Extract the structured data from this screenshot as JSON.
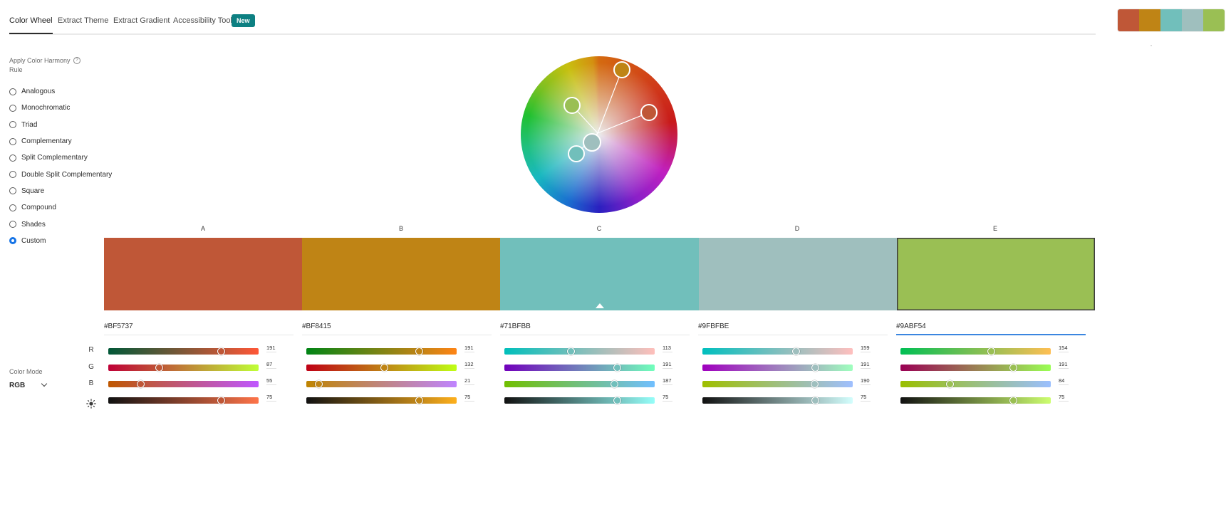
{
  "tabs": [
    {
      "label": "Color Wheel",
      "active": true
    },
    {
      "label": "Extract Theme",
      "active": false
    },
    {
      "label": "Extract Gradient",
      "active": false
    },
    {
      "label": "Accessibility Tools",
      "active": false
    }
  ],
  "new_badge": "New",
  "mini_palette": [
    "#BF5737",
    "#BF8415",
    "#71BFBB",
    "#9FBFBE",
    "#9ABF54"
  ],
  "sidebar": {
    "harmony_label": "Apply Color Harmony Rule",
    "help_icon": "?",
    "rules": [
      {
        "label": "Analogous",
        "checked": false
      },
      {
        "label": "Monochromatic",
        "checked": false
      },
      {
        "label": "Triad",
        "checked": false
      },
      {
        "label": "Complementary",
        "checked": false
      },
      {
        "label": "Split Complementary",
        "checked": false
      },
      {
        "label": "Double Split Complementary",
        "checked": false
      },
      {
        "label": "Square",
        "checked": false
      },
      {
        "label": "Compound",
        "checked": false
      },
      {
        "label": "Shades",
        "checked": false
      },
      {
        "label": "Custom",
        "checked": true
      }
    ],
    "color_mode_label": "Color Mode",
    "color_mode_value": "RGB"
  },
  "channels": [
    "R",
    "G",
    "B"
  ],
  "brightness_icon": "sun-icon",
  "swatches": [
    {
      "letter": "A",
      "hex": "#BF5737",
      "color": "#BF5737",
      "r": 191,
      "g": 87,
      "b": 55,
      "brightness": 75,
      "selected": false,
      "base": false
    },
    {
      "letter": "B",
      "hex": "#BF8415",
      "color": "#BF8415",
      "r": 191,
      "g": 132,
      "b": 21,
      "brightness": 75,
      "selected": false,
      "base": false
    },
    {
      "letter": "C",
      "hex": "#71BFBB",
      "color": "#71BFBB",
      "r": 113,
      "g": 191,
      "b": 187,
      "brightness": 75,
      "selected": false,
      "base": true
    },
    {
      "letter": "D",
      "hex": "#9FBFBE",
      "color": "#9FBFBE",
      "r": 159,
      "g": 191,
      "b": 190,
      "brightness": 75,
      "selected": false,
      "base": false
    },
    {
      "letter": "E",
      "hex": "#9ABF54",
      "color": "#9ABF54",
      "r": 154,
      "g": 191,
      "b": 84,
      "brightness": 75,
      "selected": true,
      "base": false
    }
  ]
}
